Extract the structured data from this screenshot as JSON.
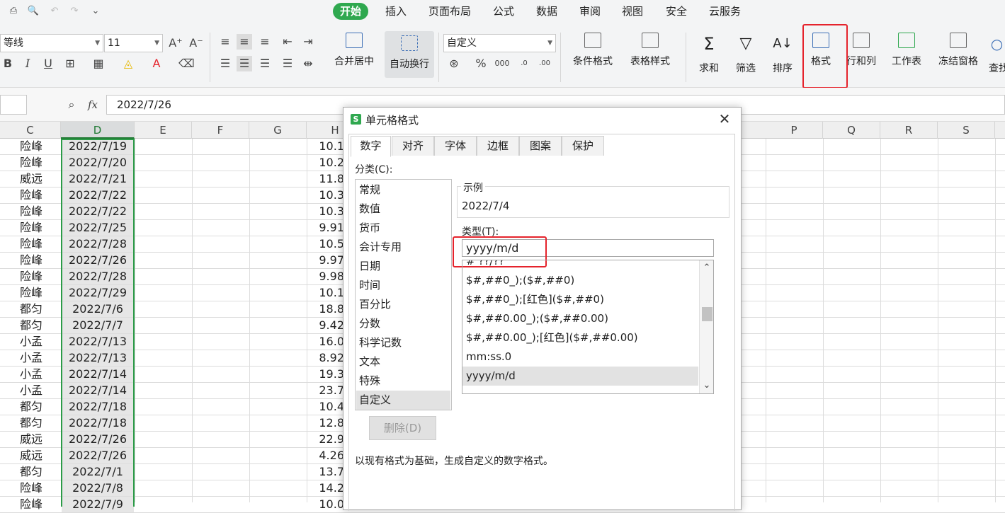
{
  "menubar": {
    "tabs": [
      "开始",
      "插入",
      "页面布局",
      "公式",
      "数据",
      "审阅",
      "视图",
      "安全",
      "云服务"
    ],
    "active_tab": "开始",
    "accent": "#2fa84f"
  },
  "ribbon": {
    "font_name": "等线",
    "font_size": "11",
    "number_format": "自定义",
    "buttons": {
      "merge_center": "合并居中",
      "auto_wrap": "自动换行",
      "cond_format": "条件格式",
      "table_style": "表格样式",
      "sum": "求和",
      "filter": "筛选",
      "sort": "排序",
      "format": "格式",
      "row_col": "行和列",
      "worksheet": "工作表",
      "freeze": "冻结窗格",
      "find": "查找"
    },
    "highlight_color": "#e5232c"
  },
  "formula_bar": {
    "fx": "fx",
    "value": "2022/7/26"
  },
  "columns": [
    "C",
    "D",
    "E",
    "F",
    "G",
    "H",
    "P",
    "Q",
    "R",
    "S"
  ],
  "rows": [
    {
      "c": "险峰",
      "d": "2022/7/19",
      "h": "10.1"
    },
    {
      "c": "险峰",
      "d": "2022/7/20",
      "h": "10.2"
    },
    {
      "c": "威远",
      "d": "2022/7/21",
      "h": "11.8"
    },
    {
      "c": "险峰",
      "d": "2022/7/22",
      "h": "10.3"
    },
    {
      "c": "险峰",
      "d": "2022/7/22",
      "h": "10.3"
    },
    {
      "c": "险峰",
      "d": "2022/7/25",
      "h": "9.91"
    },
    {
      "c": "险峰",
      "d": "2022/7/28",
      "h": "10.5"
    },
    {
      "c": "险峰",
      "d": "2022/7/26",
      "h": "9.97"
    },
    {
      "c": "险峰",
      "d": "2022/7/28",
      "h": "9.98"
    },
    {
      "c": "险峰",
      "d": "2022/7/29",
      "h": "10.1"
    },
    {
      "c": "都匀",
      "d": "2022/7/6",
      "h": "18.8"
    },
    {
      "c": "都匀",
      "d": "2022/7/7",
      "h": "9.42"
    },
    {
      "c": "小孟",
      "d": "2022/7/13",
      "h": "16.0"
    },
    {
      "c": "小孟",
      "d": "2022/7/13",
      "h": "8.92"
    },
    {
      "c": "小孟",
      "d": "2022/7/14",
      "h": "19.3"
    },
    {
      "c": "小孟",
      "d": "2022/7/14",
      "h": "23.7"
    },
    {
      "c": "都匀",
      "d": "2022/7/18",
      "h": "10.4"
    },
    {
      "c": "都匀",
      "d": "2022/7/18",
      "h": "12.8"
    },
    {
      "c": "威远",
      "d": "2022/7/26",
      "h": "22.9"
    },
    {
      "c": "威远",
      "d": "2022/7/26",
      "h": "4.26"
    },
    {
      "c": "都匀",
      "d": "2022/7/1",
      "h": "13.7"
    },
    {
      "c": "险峰",
      "d": "2022/7/8",
      "h": "14.2"
    },
    {
      "c": "险峰",
      "d": "2022/7/9",
      "h": "10.0"
    }
  ],
  "dialog": {
    "title": "单元格格式",
    "tabs": [
      "数字",
      "对齐",
      "字体",
      "边框",
      "图案",
      "保护"
    ],
    "active_tab": "数字",
    "category_label": "分类(C):",
    "categories": [
      "常规",
      "数值",
      "货币",
      "会计专用",
      "日期",
      "时间",
      "百分比",
      "分数",
      "科学记数",
      "文本",
      "特殊",
      "自定义"
    ],
    "selected_category": "自定义",
    "sample_label": "示例",
    "sample_value": "2022/7/4",
    "type_label": "类型(T):",
    "type_value": "yyyy/m/d",
    "format_list": [
      "# ??/??",
      "$#,##0_);($#,##0)",
      "$#,##0_);[红色]($#,##0)",
      "$#,##0.00_);($#,##0.00)",
      "$#,##0.00_);[红色]($#,##0.00)",
      "mm:ss.0",
      "yyyy/m/d"
    ],
    "selected_format": "yyyy/m/d",
    "delete_button": "删除(D)",
    "hint": "以现有格式为基础，生成自定义的数字格式。"
  }
}
